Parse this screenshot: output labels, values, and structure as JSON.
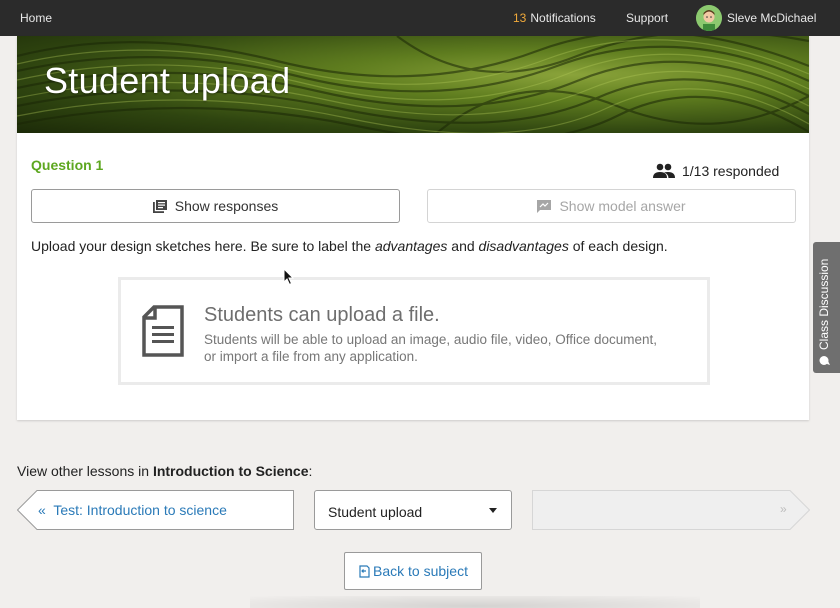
{
  "nav": {
    "home": "Home",
    "notifications_count": "13",
    "notifications_label": "Notifications",
    "support": "Support",
    "user_name": "Sleve McDichael"
  },
  "lesson": {
    "title": "Student upload",
    "question_label": "Question 1",
    "responded": "1/13 responded",
    "show_responses": "Show responses",
    "show_model_answer": "Show model answer",
    "instructions_pre": "Upload your design sketches here. Be sure to label the ",
    "instructions_em1": "advantages",
    "instructions_mid": " and ",
    "instructions_em2": "disadvantages",
    "instructions_post": " of each design.",
    "upload_title": "Students can upload a file.",
    "upload_desc_line1": "Students will be able to upload an image, audio file, video, Office document,",
    "upload_desc_line2": "or import a file from any application."
  },
  "side_tab": {
    "label": "Class Discussion"
  },
  "footer": {
    "other_prefix": "View other lessons in ",
    "subject_name": "Introduction to Science",
    "other_suffix": ":",
    "prev_lesson": "«  Test: Introduction to science",
    "current_lesson": "Student upload",
    "next_symbol": "»",
    "back_label": "Back to subject"
  },
  "colors": {
    "accent_green": "#5da71f",
    "link_blue": "#2a7ab8",
    "notification_orange": "#f0a93a",
    "topbar": "#2b2b2b"
  },
  "icons": [
    "people-icon",
    "responses-icon",
    "model-answer-icon",
    "document-icon",
    "chat-icon",
    "back-icon",
    "avatar"
  ]
}
